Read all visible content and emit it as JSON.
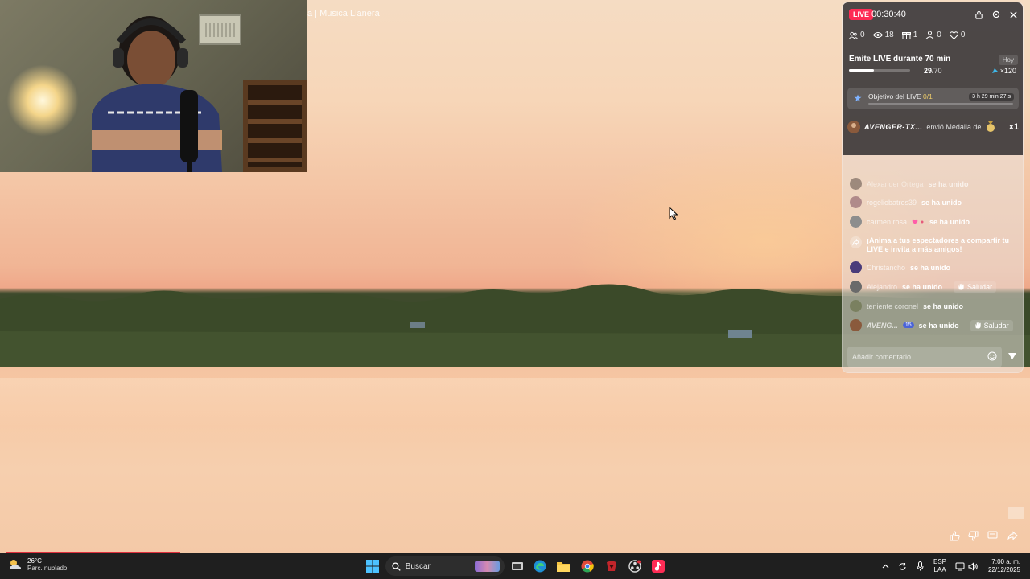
{
  "video": {
    "title_fragment": "a | Musica Llanera"
  },
  "live_panel": {
    "live_badge": "LIVE",
    "timer": "00:30:40",
    "stats": {
      "users": "0",
      "views": "18",
      "gifts": "1",
      "shares": "0",
      "likes": "0"
    },
    "goal": {
      "title": "Emite LIVE durante 70 min",
      "day_label": "Hoy",
      "current": "29",
      "total": "/70",
      "progress_fraction": 0.41,
      "reward": "×120"
    },
    "objective": {
      "label": "Objetivo del LIVE ",
      "count": "0/1",
      "time_left": "3 h 29 min 27 s",
      "progress_fraction": 0
    },
    "gift": {
      "sender": "AVENGER-TX...",
      "message": "envió Medalla de",
      "multiplier": "x1"
    },
    "chat": [
      {
        "name": "Alexander Ortega",
        "action": "se ha unido"
      },
      {
        "name": "rogeliobatres39",
        "action": "se ha unido"
      },
      {
        "name": "carmen rosa",
        "action": "se ha unido"
      },
      {
        "name": "Christancho",
        "action": "se ha unido"
      },
      {
        "name": "Alejandro",
        "action": "se ha unido",
        "greet": "Saludar"
      },
      {
        "name": "teniente coronel",
        "action": "se ha unido"
      },
      {
        "name": "AVENG...",
        "badge": "15",
        "action": "se ha unido",
        "greet": "Saludar"
      }
    ],
    "invite_message": "¡Anima a tus espectadores a compartir tu LIVE e invita a más amigos!",
    "comment_placeholder": "Añadir comentario"
  },
  "taskbar": {
    "weather_temp": "26°C",
    "weather_desc": "Parc. nublado",
    "search_placeholder": "Buscar",
    "lang_top": "ESP",
    "lang_bottom": "LAA",
    "time": "7:00 a. m.",
    "date": "22/12/2025"
  },
  "colors": {
    "live_red": "#fe2c55",
    "taskbar_bg": "#1f1f1f",
    "progress_red": "#e0303e"
  }
}
